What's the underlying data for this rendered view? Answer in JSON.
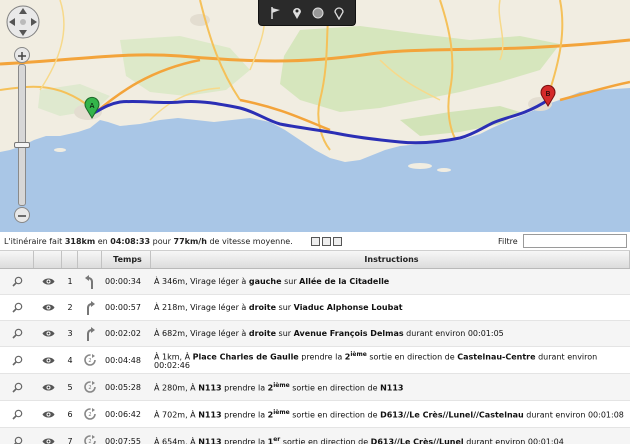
{
  "map": {
    "tools": [
      "flag-icon",
      "pin-icon",
      "circle-icon",
      "pin-outline-icon"
    ],
    "route_color": "#2b2fb5",
    "start_marker_color": "#33b44a",
    "end_marker_color": "#d42a2a"
  },
  "summary": {
    "prefix": "L'itinéraire fait ",
    "distance": "318km",
    "mid1": " en ",
    "duration": "04:08:33",
    "mid2": " pour ",
    "speed": "77km/h",
    "suffix": " de vitesse moyenne.",
    "filter_label": "Filtre",
    "filter_value": ""
  },
  "table": {
    "headers": {
      "time": "Temps",
      "instructions": "Instructions"
    },
    "rows": [
      {
        "num": "1",
        "time": "00:00:34",
        "parts": [
          [
            "À 346m, Virage léger à ",
            0
          ],
          [
            "gauche",
            1
          ],
          [
            " sur ",
            0
          ],
          [
            "Allée de la Citadelle",
            1
          ]
        ]
      },
      {
        "num": "2",
        "time": "00:00:57",
        "parts": [
          [
            "À 218m, Virage léger à ",
            0
          ],
          [
            "droite",
            1
          ],
          [
            " sur ",
            0
          ],
          [
            "Viaduc Alphonse Loubat",
            1
          ]
        ]
      },
      {
        "num": "3",
        "time": "00:02:02",
        "parts": [
          [
            "À 682m, Virage léger à ",
            0
          ],
          [
            "droite",
            1
          ],
          [
            " sur ",
            0
          ],
          [
            "Avenue François Delmas",
            1
          ],
          [
            " durant environ 00:01:05",
            0
          ]
        ]
      },
      {
        "num": "4",
        "time": "00:04:48",
        "parts": [
          [
            "À 1km, À ",
            0
          ],
          [
            "Place Charles de Gaulle",
            1
          ],
          [
            " prendre la ",
            0
          ],
          [
            "2",
            1
          ],
          [
            "ième",
            2
          ],
          [
            " sortie en direction de ",
            0
          ],
          [
            "Castelnau-Centre",
            1
          ],
          [
            " durant environ 00:02:46",
            0
          ]
        ]
      },
      {
        "num": "5",
        "time": "00:05:28",
        "parts": [
          [
            "À 280m, À ",
            0
          ],
          [
            "N113",
            1
          ],
          [
            " prendre la ",
            0
          ],
          [
            "2",
            1
          ],
          [
            "ième",
            2
          ],
          [
            " sortie en direction de ",
            0
          ],
          [
            "N113",
            1
          ]
        ]
      },
      {
        "num": "6",
        "time": "00:06:42",
        "parts": [
          [
            "À 702m, À ",
            0
          ],
          [
            "N113",
            1
          ],
          [
            " prendre la ",
            0
          ],
          [
            "2",
            1
          ],
          [
            "ième",
            2
          ],
          [
            " sortie en direction de ",
            0
          ],
          [
            "D613//Le Crès//Lunel//Castelnau",
            1
          ],
          [
            " durant environ 00:01:08",
            0
          ]
        ]
      },
      {
        "num": "7",
        "time": "00:07:55",
        "parts": [
          [
            "À 654m, À ",
            0
          ],
          [
            "N113",
            1
          ],
          [
            " prendre la ",
            0
          ],
          [
            "1",
            1
          ],
          [
            "er",
            2
          ],
          [
            " sortie en direction de ",
            0
          ],
          [
            "D613//Le Crès//Lunel",
            1
          ],
          [
            " durant environ 00:01:04",
            0
          ]
        ]
      }
    ]
  }
}
